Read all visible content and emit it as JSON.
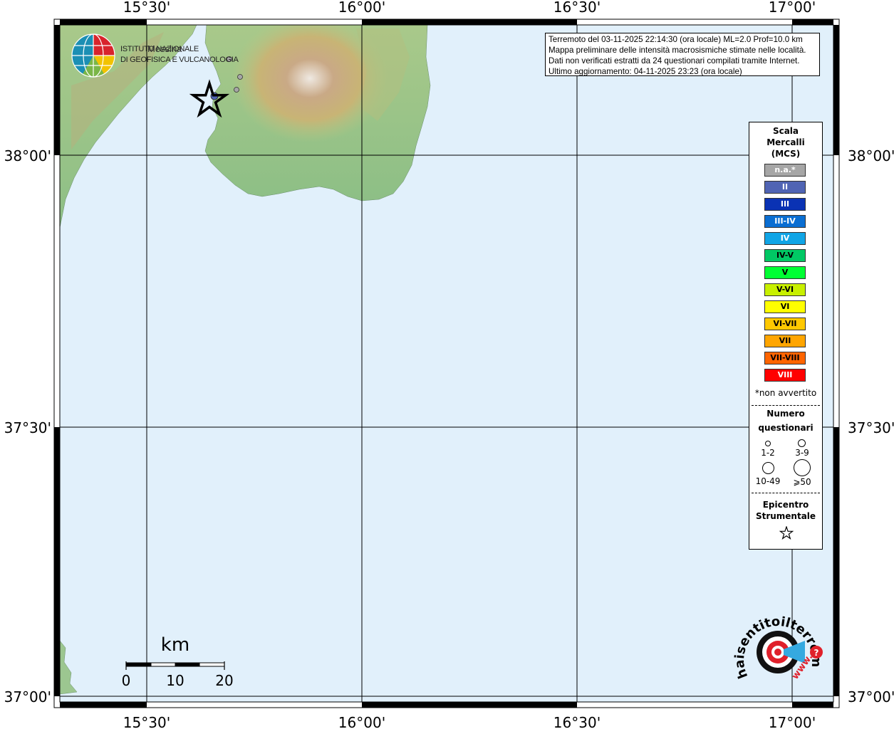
{
  "map": {
    "lon_ticks": [
      "15°30'",
      "16°00'",
      "16°30'",
      "17°00'"
    ],
    "lat_ticks": [
      "38°00'",
      "37°30'",
      "37°00'"
    ],
    "colors": {
      "sea": "#e1f0fb",
      "frame": "#000000",
      "grid": "#000000"
    }
  },
  "info_box": {
    "lines": [
      "Terremoto del 03-11-2025 22:14:30 (ora locale) ML=2.0 Prof=10.0 km",
      "Mappa preliminare delle intensità macrosismiche stimate nelle località.",
      "Dati non verificati estratti da 24 questionari compilati tramite Internet.",
      "Ultimo aggiornamento: 04-11-2025 23:23 (ora locale)"
    ]
  },
  "legend": {
    "title": [
      "Scala",
      "Mercalli",
      "(MCS)"
    ],
    "intensities": [
      {
        "label": "n.a.*",
        "color": "#a6a6a6",
        "text_color": "#ffffff"
      },
      {
        "label": "II",
        "color": "#5064b4",
        "text_color": "#ffffff"
      },
      {
        "label": "III",
        "color": "#0a32b4",
        "text_color": "#ffffff"
      },
      {
        "label": "III-IV",
        "color": "#0a6ed2",
        "text_color": "#ffffff"
      },
      {
        "label": "IV",
        "color": "#10a5e6",
        "text_color": "#ffffff"
      },
      {
        "label": "IV-V",
        "color": "#00c864",
        "text_color": "#000000"
      },
      {
        "label": "V",
        "color": "#00ff33",
        "text_color": "#000000"
      },
      {
        "label": "V-VI",
        "color": "#c8f000",
        "text_color": "#000000"
      },
      {
        "label": "VI",
        "color": "#ffff00",
        "text_color": "#000000"
      },
      {
        "label": "VI-VII",
        "color": "#ffc800",
        "text_color": "#000000"
      },
      {
        "label": "VII",
        "color": "#ffa500",
        "text_color": "#000000"
      },
      {
        "label": "VII-VIII",
        "color": "#ff6400",
        "text_color": "#000000"
      },
      {
        "label": "VIII",
        "color": "#ff0000",
        "text_color": "#ffffff"
      }
    ],
    "not_felt_note": "*non avvertito",
    "count_title": [
      "Numero",
      "questionari"
    ],
    "count_classes": [
      "1-2",
      "3-9",
      "10-49",
      "⩾50"
    ],
    "epicenter_title": [
      "Epicentro",
      "Strumentale"
    ]
  },
  "scale_bar": {
    "unit": "km",
    "labels": [
      "0",
      "10",
      "20"
    ]
  },
  "ingv": {
    "line1": "ISTITUTO NAZIONALE",
    "line2": "DI GEOFISICA E VULCANOLOGIA"
  },
  "place_label": "Messina",
  "epicenter": {
    "intensity": "II"
  },
  "hsit_logo": {
    "text": "haisentitoilterremoto.it",
    "url_text": "www."
  }
}
